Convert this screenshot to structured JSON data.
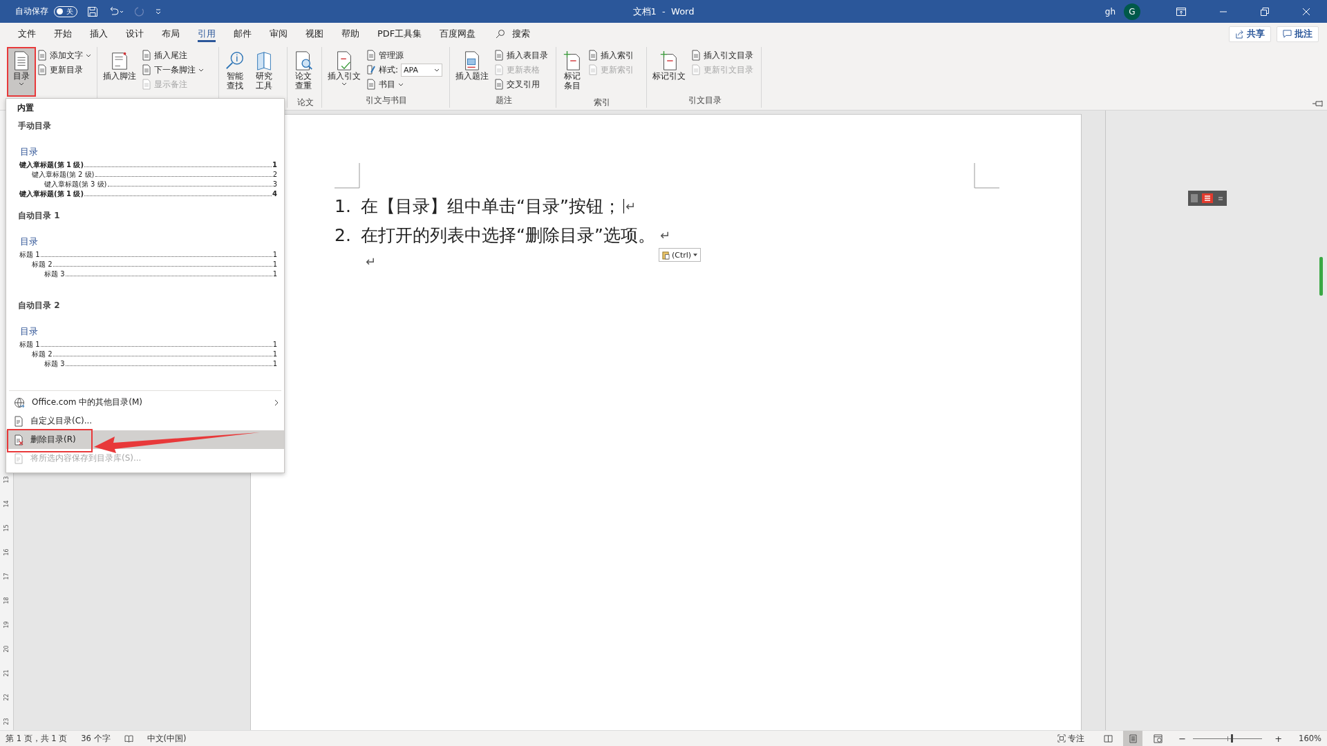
{
  "title_bar": {
    "autosave_label": "自动保存",
    "autosave": {
      "label": "关",
      "on": false
    },
    "title": "文档1  -  Word",
    "user": "gh",
    "avatar": "G"
  },
  "tabs": [
    {
      "label": "文件",
      "selected": false
    },
    {
      "label": "开始",
      "selected": false
    },
    {
      "label": "插入",
      "selected": false
    },
    {
      "label": "设计",
      "selected": false
    },
    {
      "label": "布局",
      "selected": false
    },
    {
      "label": "引用",
      "selected": true
    },
    {
      "label": "邮件",
      "selected": false
    },
    {
      "label": "审阅",
      "selected": false
    },
    {
      "label": "视图",
      "selected": false
    },
    {
      "label": "帮助",
      "selected": false
    },
    {
      "label": "PDF工具集",
      "selected": false
    },
    {
      "label": "百度网盘",
      "selected": false
    }
  ],
  "search": {
    "label": "搜索"
  },
  "share_button": {
    "label": "共享"
  },
  "comments_button": {
    "label": "批注"
  },
  "ribbon_groups": [
    {
      "big": [
        {
          "lines": [
            "目录"
          ],
          "menu": true,
          "pressed": true,
          "annotated": true
        }
      ],
      "items": [
        {
          "label": "添加文字",
          "kind": "menu",
          "disabled": false
        },
        {
          "label": "更新目录",
          "kind": "button",
          "disabled": false
        }
      ]
    },
    {
      "big": [
        {
          "lines": [
            "插入脚注"
          ],
          "menu": false,
          "pressed": false,
          "annotated": false
        }
      ],
      "items": [
        {
          "label": "插入尾注",
          "kind": "button",
          "disabled": false
        },
        {
          "label": "下一条脚注",
          "kind": "menu",
          "disabled": false
        },
        {
          "label": "显示备注",
          "kind": "button",
          "disabled": true
        }
      ]
    },
    {
      "big": [
        {
          "lines": [
            "智能",
            "查找"
          ],
          "menu": false,
          "pressed": false,
          "annotated": false
        },
        {
          "lines": [
            "研究",
            "工具"
          ],
          "menu": false,
          "pressed": false,
          "annotated": false
        }
      ]
    },
    {
      "label": "论文",
      "big": [
        {
          "lines": [
            "论文",
            "查重"
          ],
          "menu": false,
          "pressed": false,
          "annotated": false
        }
      ]
    },
    {
      "label": "引文与书目",
      "big": [
        {
          "lines": [
            "插入引文"
          ],
          "menu": true,
          "pressed": false,
          "annotated": false
        }
      ],
      "items": [
        {
          "label": "管理源",
          "kind": "button",
          "disabled": false
        },
        {
          "label": "样式:",
          "kind": "combo",
          "value": "APA",
          "disabled": false
        },
        {
          "label": "书目",
          "kind": "menu",
          "disabled": false
        }
      ]
    },
    {
      "label": "题注",
      "big": [
        {
          "lines": [
            "插入题注"
          ],
          "menu": false,
          "pressed": false,
          "annotated": false
        }
      ],
      "items": [
        {
          "label": "插入表目录",
          "kind": "button",
          "disabled": false
        },
        {
          "label": "更新表格",
          "kind": "button",
          "disabled": true
        },
        {
          "label": "交叉引用",
          "kind": "button",
          "disabled": false
        }
      ]
    },
    {
      "label": "索引",
      "big": [
        {
          "lines": [
            "标记",
            "条目"
          ],
          "menu": false,
          "pressed": false,
          "annotated": false
        }
      ],
      "items": [
        {
          "label": "插入索引",
          "kind": "button",
          "disabled": false
        },
        {
          "label": "更新索引",
          "kind": "button",
          "disabled": true
        }
      ]
    },
    {
      "label": "引文目录",
      "big": [
        {
          "lines": [
            "标记引文"
          ],
          "menu": false,
          "pressed": false,
          "annotated": false
        }
      ],
      "items": [
        {
          "label": "插入引文目录",
          "kind": "button",
          "disabled": false
        },
        {
          "label": "更新引文目录",
          "kind": "button",
          "disabled": true
        }
      ]
    }
  ],
  "dropdown": {
    "section": "内置",
    "gallery": [
      {
        "title": "手动目录",
        "heading": "目录",
        "entries": [
          {
            "text": "键入章标题(第 1 级)",
            "page": "1",
            "bold": true,
            "children": [
              {
                "text": "键入章标题(第 2 级)",
                "page": "2",
                "bold": false,
                "children": [
                  {
                    "text": "键入章标题(第 3 级)",
                    "page": "3",
                    "bold": false
                  }
                ]
              }
            ]
          },
          {
            "text": "键入章标题(第 1 级)",
            "page": "4",
            "bold": true
          }
        ]
      },
      {
        "title": "自动目录 1",
        "heading": "目录",
        "entries": [
          {
            "text": "标题 1",
            "page": "1",
            "bold": false,
            "children": [
              {
                "text": "标题 2",
                "page": "1",
                "bold": false,
                "children": [
                  {
                    "text": "标题 3",
                    "page": "1",
                    "bold": false
                  }
                ]
              }
            ]
          }
        ]
      },
      {
        "title": "自动目录 2",
        "heading": "目录",
        "entries": [
          {
            "text": "标题 1",
            "page": "1",
            "bold": false,
            "children": [
              {
                "text": "标题 2",
                "page": "1",
                "bold": false,
                "children": [
                  {
                    "text": "标题 3",
                    "page": "1",
                    "bold": false
                  }
                ]
              }
            ]
          }
        ]
      }
    ],
    "commands": [
      {
        "label": "Office.com 中的其他目录(M)",
        "submenu": true,
        "selected": false,
        "disabled": false,
        "annotated": false
      },
      {
        "label": "自定义目录(C)...",
        "submenu": false,
        "selected": false,
        "disabled": false,
        "annotated": false
      },
      {
        "label": "删除目录(R)",
        "submenu": false,
        "selected": true,
        "disabled": false,
        "annotated": true
      },
      {
        "label": "将所选内容保存到目录库(S)...",
        "submenu": false,
        "selected": false,
        "disabled": true,
        "annotated": false
      }
    ]
  },
  "vertical_ruler": {
    "labels": [
      "13",
      "14",
      "15",
      "16",
      "17",
      "18",
      "19",
      "20",
      "21",
      "22",
      "23"
    ]
  },
  "document": {
    "paragraphs": [
      {
        "number": "1.",
        "text": "在【目录】组中单击“目录”按钮；",
        "mark": "↵",
        "cursor": true
      },
      {
        "number": "2.",
        "text": "在打开的列表中选择“删除目录”选项。",
        "mark": "↵",
        "cursor": false
      },
      {
        "mark": "↵",
        "cursor": false
      }
    ],
    "paste_options": {
      "label": "(Ctrl)"
    }
  },
  "status_bar": {
    "pages": "第 1 页，共 1 页",
    "words": "36 个字",
    "language": "中文(中国)",
    "focus": "专注",
    "views": [
      {
        "selected": false
      },
      {
        "selected": true
      },
      {
        "selected": false
      }
    ],
    "zoom_out": "−",
    "zoom_in": "+",
    "zoom": {
      "level": 0.56
    },
    "zoom_percent": "160%"
  }
}
